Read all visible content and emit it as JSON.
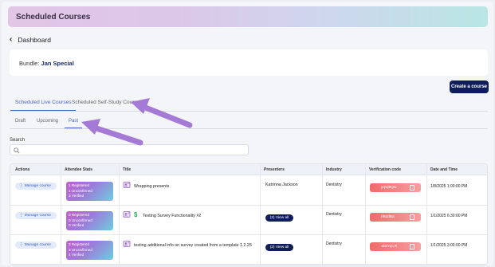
{
  "header": {
    "title": "Scheduled Courses"
  },
  "nav": {
    "back_label": "Dashboard"
  },
  "bundle": {
    "label": "Bundle:",
    "name": "Jan Special"
  },
  "actions": {
    "create_course": "Create a course"
  },
  "tabs": {
    "main": [
      {
        "label": "Scheduled Live Courses",
        "active": true
      },
      {
        "label": "Scheduled Self-Study Courses",
        "active": false
      }
    ],
    "sub": [
      {
        "label": "Draft",
        "active": false
      },
      {
        "label": "Upcoming",
        "active": false
      },
      {
        "label": "Past",
        "active": true
      }
    ]
  },
  "search": {
    "label": "Search",
    "placeholder": "",
    "value": ""
  },
  "table": {
    "columns": [
      "Actions",
      "Attendee Stats",
      "Title",
      "Presenters",
      "Industry",
      "Verification code",
      "Date and Time"
    ],
    "rows": [
      {
        "action": "Manage course",
        "stats": [
          "1 Registered",
          "1 Unconfirmed",
          "3 Verified"
        ],
        "title": "Wrapping presents",
        "has_dollar": false,
        "presenter": "Katrinna Jackson",
        "industry": "Dentistry",
        "code": "yqwj9Qw",
        "datetime": "1/8/2025 1:00:00 PM"
      },
      {
        "action": "Manage course",
        "stats": [
          "0 Registered",
          "0 Unconfirmed",
          "0 Verified"
        ],
        "title": "Testing Survey Functionality #2",
        "has_dollar": true,
        "presenter": "(2) View all",
        "industry": "Dentistry",
        "code": "rf6ddBa",
        "datetime": "1/1/2025 6:30:00 PM"
      },
      {
        "action": "Manage course",
        "stats": [
          "3 Registered",
          "3 Unconfirmed",
          "4 Verified"
        ],
        "title": "testing additional info on survey created from a template 1.2.25",
        "has_dollar": false,
        "presenter": "(2) View all",
        "industry": "Dentistry",
        "code": "3k8YqCR",
        "datetime": "1/1/2025 3:00:00 PM"
      }
    ]
  },
  "colors": {
    "accent": "#4b63c2",
    "navy": "#0f1e5a",
    "arrow": "#a57ad6",
    "code_red": "#f06a6a"
  }
}
